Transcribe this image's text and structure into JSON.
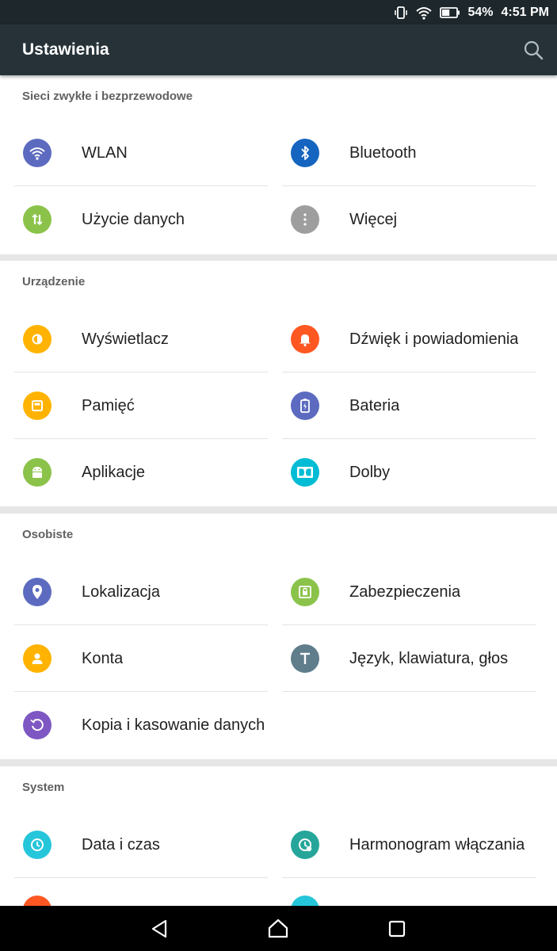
{
  "status_bar": {
    "battery_percent": "54%",
    "time": "4:51 PM",
    "icons": [
      "vibrate-icon",
      "wifi-icon",
      "battery-icon"
    ],
    "battery_level": 0.54
  },
  "app_bar": {
    "title": "Ustawienia",
    "search_icon": "search-icon",
    "background": "#263238"
  },
  "sections": [
    {
      "title": "Sieci zwykłe i bezprzewodowe",
      "items": [
        {
          "label": "WLAN",
          "icon": "wifi-icon",
          "color": "#5c6bc0"
        },
        {
          "label": "Bluetooth",
          "icon": "bluetooth-icon",
          "color": "#1565c0"
        },
        {
          "label": "Użycie danych",
          "icon": "data-usage-icon",
          "color": "#8bc34a"
        },
        {
          "label": "Więcej",
          "icon": "more-icon",
          "color": "#9e9e9e"
        }
      ]
    },
    {
      "title": "Urządzenie",
      "items": [
        {
          "label": "Wyświetlacz",
          "icon": "display-icon",
          "color": "#ffb300"
        },
        {
          "label": "Dźwięk i powiadomienia",
          "icon": "bell-icon",
          "color": "#ff5722"
        },
        {
          "label": "Pamięć",
          "icon": "storage-icon",
          "color": "#ffb300"
        },
        {
          "label": "Bateria",
          "icon": "battery-icon",
          "color": "#5c6bc0"
        },
        {
          "label": "Aplikacje",
          "icon": "android-icon",
          "color": "#8bc34a"
        },
        {
          "label": "Dolby",
          "icon": "dolby-icon",
          "color": "#00bcd4"
        }
      ]
    },
    {
      "title": "Osobiste",
      "items": [
        {
          "label": "Lokalizacja",
          "icon": "location-pin-icon",
          "color": "#5c6bc0"
        },
        {
          "label": "Zabezpieczenia",
          "icon": "lock-icon",
          "color": "#8bc34a"
        },
        {
          "label": "Konta",
          "icon": "account-icon",
          "color": "#ffb300"
        },
        {
          "label": "Język, klawiatura, głos",
          "icon": "language-icon",
          "color": "#607d8b"
        },
        {
          "label": "Kopia i kasowanie danych",
          "icon": "backup-restore-icon",
          "color": "#7e57c2"
        }
      ]
    },
    {
      "title": "System",
      "items": [
        {
          "label": "Data i czas",
          "icon": "clock-icon",
          "color": "#26c6da"
        },
        {
          "label": "Harmonogram włączania",
          "icon": "schedule-power-icon",
          "color": "#26a69a"
        }
      ]
    }
  ],
  "nav_bar": {
    "icons": [
      "back-icon",
      "home-icon",
      "recents-icon"
    ]
  }
}
